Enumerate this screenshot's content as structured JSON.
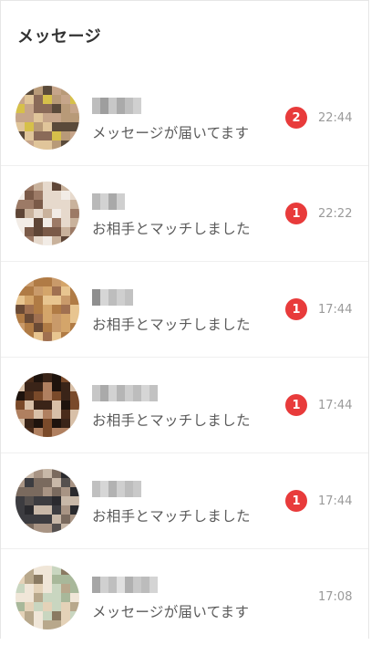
{
  "header": {
    "title": "メッセージ"
  },
  "conversations": [
    {
      "preview": "メッセージが届いてます",
      "unread": "2",
      "time": "22:44",
      "name_tint": [
        "#bdbdbd",
        "#9e9e9e",
        "#c8c8c8",
        "#aaaaaa",
        "#bfbfbf",
        "#d0d0d0"
      ],
      "avatar_colors": [
        "#c6a58a",
        "#8a6a58",
        "#e0c59a",
        "#5a4a3a",
        "#d6c04a",
        "#b89a78"
      ]
    },
    {
      "preview": "お相手とマッチしました",
      "unread": "1",
      "time": "22:22",
      "name_tint": [
        "#b9b9b9",
        "#d2d2d2",
        "#a9a9a9",
        "#cfcfcf"
      ],
      "avatar_colors": [
        "#c9b29c",
        "#7a5a48",
        "#e6d9cc",
        "#9c7a66",
        "#f2ece6",
        "#5e4536"
      ]
    },
    {
      "preview": "お相手とマッチしました",
      "unread": "1",
      "time": "17:44",
      "name_tint": [
        "#8f8f8f",
        "#d6d6d6",
        "#bdbdbd",
        "#cfcfcf",
        "#c2c2c2"
      ],
      "avatar_colors": [
        "#d4a56a",
        "#b07b45",
        "#e8c590",
        "#6a4a35",
        "#c99a6a",
        "#a07050"
      ]
    },
    {
      "preview": "お相手とマッチしました",
      "unread": "1",
      "time": "17:44",
      "name_tint": [
        "#c6c6c6",
        "#aaaaaa",
        "#d2d2d2",
        "#b5b5b5",
        "#cdcdcd",
        "#bdbdbd",
        "#d6d6d6",
        "#c2c2c2"
      ],
      "avatar_colors": [
        "#3a2418",
        "#7a4a2a",
        "#1e130d",
        "#b08060",
        "#4a2c1a",
        "#d8c0a8"
      ]
    },
    {
      "preview": "お相手とマッチしました",
      "unread": "1",
      "time": "17:44",
      "name_tint": [
        "#c0c0c0",
        "#d6d6d6",
        "#b2b2b2",
        "#cfcfcf",
        "#bdbdbd",
        "#c9c9c9"
      ],
      "avatar_colors": [
        "#3c3c40",
        "#7a6a5e",
        "#2a2a2e",
        "#a89484",
        "#55504e",
        "#c8b8a8"
      ]
    },
    {
      "preview": "メッセージが届いてます",
      "unread": "",
      "time": "17:08",
      "name_tint": [
        "#a6a6a6",
        "#d0d0d0",
        "#bfbfbf",
        "#e0e0e0",
        "#b0b0b0",
        "#c8c8c8",
        "#bcbcbc",
        "#d4d4d4"
      ],
      "avatar_colors": [
        "#c9d6c0",
        "#e4d2b8",
        "#a8b89a",
        "#8a7a62",
        "#f0e6d8",
        "#b8a88c"
      ]
    }
  ]
}
